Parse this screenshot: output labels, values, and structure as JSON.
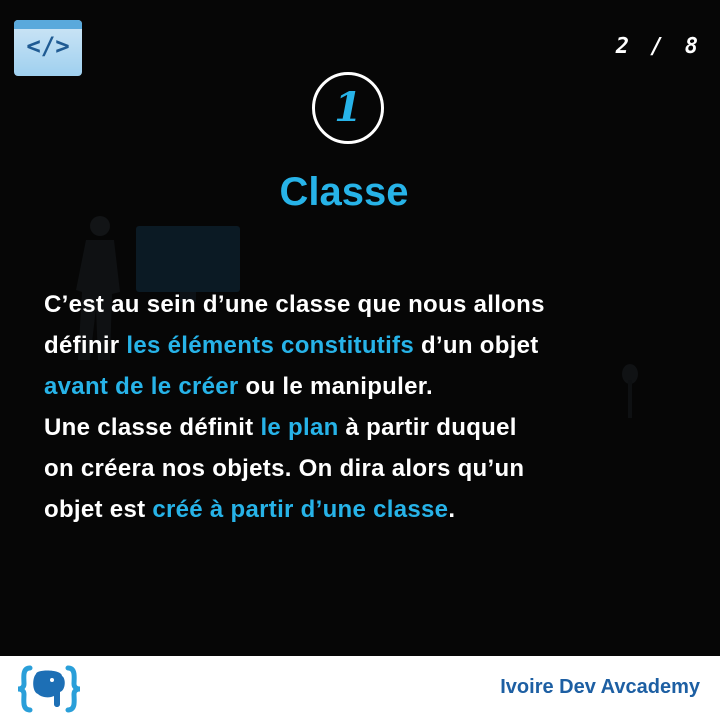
{
  "header": {
    "code_icon_label": "</>",
    "page_indicator": "2 / 8"
  },
  "step": {
    "number": "1"
  },
  "title": "Classe",
  "body": {
    "line1": [
      {
        "text": "C’est au sein d’une classe que nous allons",
        "hl": false
      }
    ],
    "line2": [
      {
        "text": "définir ",
        "hl": false
      },
      {
        "text": "les éléments constitutifs",
        "hl": true
      },
      {
        "text": " d’un objet",
        "hl": false
      }
    ],
    "line3": [
      {
        "text": "avant de le créer",
        "hl": true
      },
      {
        "text": " ou le manipuler.",
        "hl": false
      }
    ],
    "line4": [
      {
        "text": "Une classe définit ",
        "hl": false
      },
      {
        "text": "le plan",
        "hl": true
      },
      {
        "text": " à partir duquel",
        "hl": false
      }
    ],
    "line5": [
      {
        "text": "on créera nos objets. On dira alors qu’un",
        "hl": false
      }
    ],
    "line6": [
      {
        "text": "objet est ",
        "hl": false
      },
      {
        "text": "créé à partir d’une classe",
        "hl": true
      },
      {
        "text": ".",
        "hl": false
      }
    ]
  },
  "footer": {
    "brand_name": "Ivoire Dev Avcademy",
    "logo_icon": "curly-brace-elephant-logo"
  },
  "colors": {
    "accent": "#27b3e8",
    "background": "#060606",
    "footer_bg": "#ffffff",
    "brand_text": "#1d5fa3"
  }
}
